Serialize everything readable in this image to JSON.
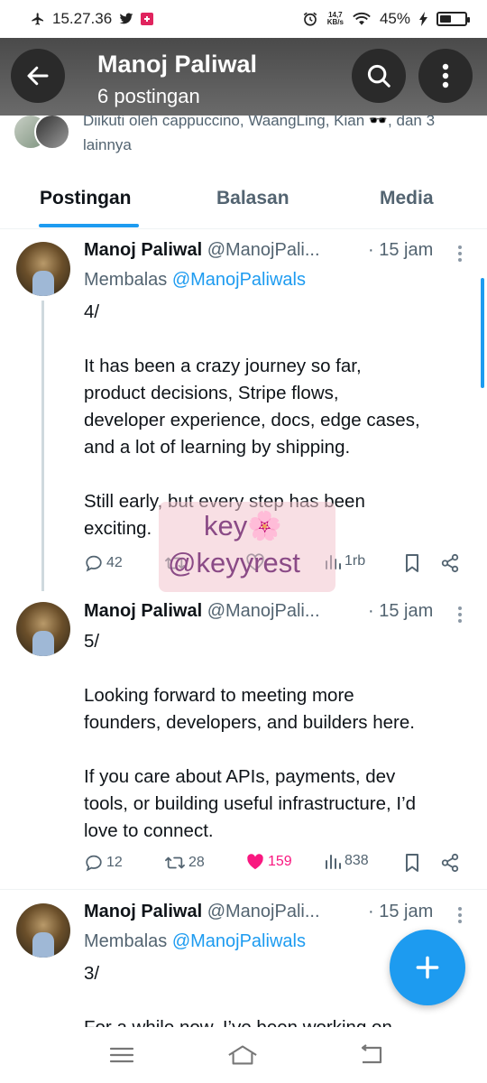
{
  "status_bar": {
    "time": "15.27.36",
    "net_speed_value": "14,7",
    "net_speed_unit": "KB/s",
    "battery_percent": "45%",
    "battery_level": 0.45
  },
  "header": {
    "name": "Manoj Paliwal",
    "post_count": "6 postingan"
  },
  "followed_by": {
    "text": "Diikuti oleh cappuccino, WaangLing, Kian 🕶️, dan 3 lainnya"
  },
  "tabs": [
    {
      "label": "Postingan",
      "active": true
    },
    {
      "label": "Balasan",
      "active": false
    },
    {
      "label": "Media",
      "active": false
    }
  ],
  "posts": [
    {
      "name": "Manoj Paliwal",
      "handle": "@ManojPali...",
      "time": "· 15 jam",
      "reply_prefix": "Membalas ",
      "reply_to": "@ManojPaliwals",
      "text": "4/\n\nIt has been a crazy journey so far,\nproduct decisions, Stripe flows,\ndeveloper experience, docs, edge cases,\nand a lot of learning by shipping.\n\nStill early, but every step has been\nexciting.",
      "replies": "42",
      "reposts": "",
      "likes": "",
      "views": "1rb"
    },
    {
      "name": "Manoj Paliwal",
      "handle": "@ManojPali...",
      "time": "· 15 jam",
      "text": "5/\n\nLooking forward to meeting more\nfounders, developers, and builders here.\n\nIf you care about APIs, payments, dev\ntools, or building useful infrastructure, I’d\nlove to connect.",
      "replies": "12",
      "reposts": "28",
      "likes": "159",
      "views": "838"
    },
    {
      "name": "Manoj Paliwal",
      "handle": "@ManojPali...",
      "time": "· 15 jam",
      "reply_prefix": "Membalas ",
      "reply_to": "@ManojPaliwals",
      "text": "3/\n\nFor a while now, I’ve been working on"
    }
  ],
  "watermark": {
    "line1": "key🌸",
    "line2": "@keyyrest"
  },
  "colors": {
    "accent": "#1d9bf0",
    "like": "#f91880",
    "secondary_text": "#536471"
  }
}
